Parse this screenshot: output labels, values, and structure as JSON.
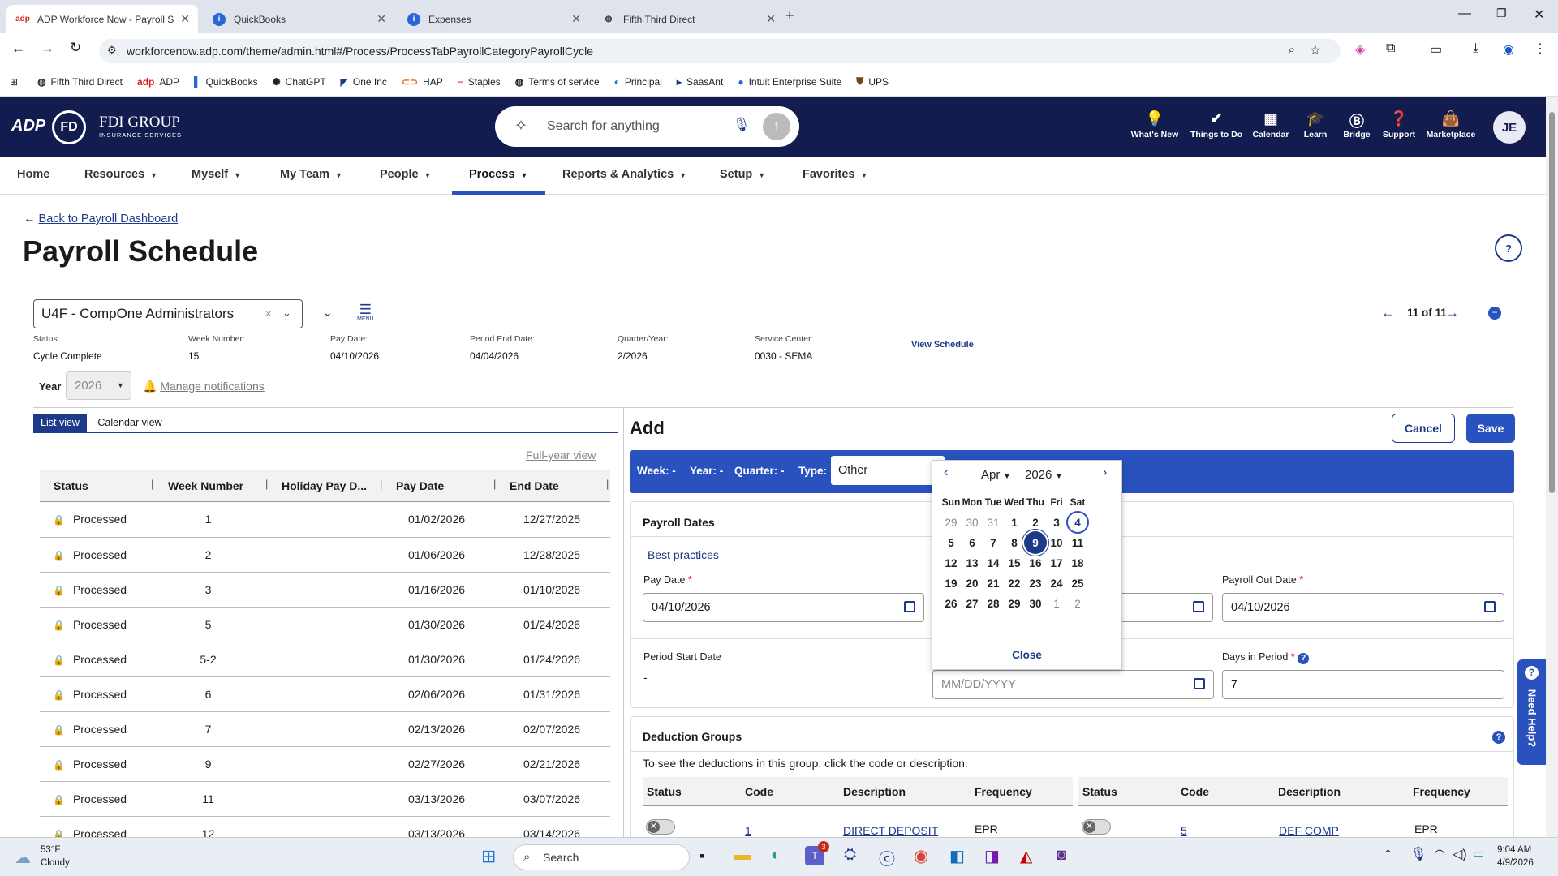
{
  "browser": {
    "tabs": [
      {
        "label": "ADP Workforce Now - Payroll S",
        "icon": "adp-icon"
      },
      {
        "label": "QuickBooks",
        "icon": "quickbooks-icon"
      },
      {
        "label": "Expenses",
        "icon": "quickbooks-icon"
      },
      {
        "label": "Fifth Third Direct",
        "icon": "globe-icon"
      }
    ],
    "url": "workforcenow.adp.com/theme/admin.html#/Process/ProcessTabPayrollCategoryPayrollCycle",
    "bookmarks": [
      "Fifth Third Direct",
      "ADP",
      "QuickBooks",
      "ChatGPT",
      "One Inc",
      "HAP",
      "Staples",
      "Terms of service",
      "Principal",
      "SaasAnt",
      "Intuit Enterprise Suite",
      "UPS"
    ]
  },
  "header": {
    "logo": "ADP",
    "company_line1": "FDI GROUP",
    "company_line2": "INSURANCE SERVICES",
    "search_placeholder": "Search for anything",
    "icons": [
      "What's New",
      "Things to Do",
      "Calendar",
      "Learn",
      "Bridge",
      "Support",
      "Marketplace"
    ],
    "avatar": "JE"
  },
  "nav": [
    "Home",
    "Resources",
    "Myself",
    "My Team",
    "People",
    "Process",
    "Reports & Analytics",
    "Setup",
    "Favorites"
  ],
  "page": {
    "back_link": "Back to Payroll Dashboard",
    "title": "Payroll Schedule",
    "company_select": "U4F - CompOne Administrators",
    "menu_label": "MENU",
    "pager": "11 of 11",
    "status_label": "Status:",
    "status": "Cycle Complete",
    "week_label": "Week Number:",
    "week": "15",
    "paydate_label": "Pay Date:",
    "paydate": "04/10/2026",
    "periodend_label": "Period End Date:",
    "periodend": "04/04/2026",
    "quarter_label": "Quarter/Year:",
    "quarter": "2/2026",
    "service_label": "Service Center:",
    "service": "0030 - SEMA",
    "view_schedule": "View Schedule",
    "year_label": "Year",
    "year": "2026",
    "manage_notifications": "Manage notifications"
  },
  "list": {
    "tab_list": "List view",
    "tab_calendar": "Calendar view",
    "full_year": "Full-year view",
    "columns": [
      "Status",
      "Week Number",
      "Holiday Pay D...",
      "Pay Date",
      "End Date"
    ],
    "rows": [
      {
        "status": "Processed",
        "week": "1",
        "pay": "01/02/2026",
        "end": "12/27/2025"
      },
      {
        "status": "Processed",
        "week": "2",
        "pay": "01/06/2026",
        "end": "12/28/2025"
      },
      {
        "status": "Processed",
        "week": "3",
        "pay": "01/16/2026",
        "end": "01/10/2026"
      },
      {
        "status": "Processed",
        "week": "5",
        "pay": "01/30/2026",
        "end": "01/24/2026"
      },
      {
        "status": "Processed",
        "week": "5-2",
        "pay": "01/30/2026",
        "end": "01/24/2026"
      },
      {
        "status": "Processed",
        "week": "6",
        "pay": "02/06/2026",
        "end": "01/31/2026"
      },
      {
        "status": "Processed",
        "week": "7",
        "pay": "02/13/2026",
        "end": "02/07/2026"
      },
      {
        "status": "Processed",
        "week": "9",
        "pay": "02/27/2026",
        "end": "02/21/2026"
      },
      {
        "status": "Processed",
        "week": "11",
        "pay": "03/13/2026",
        "end": "03/07/2026"
      },
      {
        "status": "Processed",
        "week": "12",
        "pay": "03/13/2026",
        "end": "03/14/2026"
      }
    ]
  },
  "add": {
    "title": "Add",
    "cancel": "Cancel",
    "save": "Save",
    "week_lbl": "Week: -",
    "year_lbl": "Year: -",
    "quarter_lbl": "Quarter: -",
    "type_lbl": "Type:",
    "type_value": "Other",
    "payroll_dates": "Payroll Dates",
    "best_practices": "Best practices",
    "pay_date_label": "Pay Date",
    "pay_date": "04/10/2026",
    "payroll_out_label": "Payroll Out Date",
    "payroll_out": "04/10/2026",
    "period_start_label": "Period Start Date",
    "period_start": "-",
    "period_end_placeholder": "MM/DD/YYYY",
    "days_label": "Days in Period",
    "days": "7",
    "deduction_groups": "Deduction Groups",
    "deduction_hint": "To see the deductions in this group, click the code or description.",
    "ded_columns": [
      "Status",
      "Code",
      "Description",
      "Frequency"
    ],
    "ded_left": {
      "code": "1",
      "desc": "DIRECT DEPOSIT",
      "freq": "EPR"
    },
    "ded_right": {
      "code": "5",
      "desc": "DEF COMP",
      "freq": "EPR"
    },
    "need_help": "Need Help?"
  },
  "datepicker": {
    "month": "Apr",
    "year": "2026",
    "dow": [
      "Sun",
      "Mon",
      "Tue",
      "Wed",
      "Thu",
      "Fri",
      "Sat"
    ],
    "weeks": [
      [
        "29",
        "30",
        "31",
        "1",
        "2",
        "3",
        "4"
      ],
      [
        "5",
        "6",
        "7",
        "8",
        "9",
        "10",
        "11"
      ],
      [
        "12",
        "13",
        "14",
        "15",
        "16",
        "17",
        "18"
      ],
      [
        "19",
        "20",
        "21",
        "22",
        "23",
        "24",
        "25"
      ],
      [
        "26",
        "27",
        "28",
        "29",
        "30",
        "1",
        "2"
      ]
    ],
    "selected": "9",
    "today": "4",
    "close": "Close"
  },
  "taskbar": {
    "weather_temp": "53°F",
    "weather_desc": "Cloudy",
    "search": "Search",
    "time": "9:04 AM",
    "date": "4/9/2026",
    "teams_badge": "3"
  },
  "colors": {
    "adp_navy": "#121c4e",
    "accent": "#1d3a8a",
    "banner": "#2a52be"
  }
}
